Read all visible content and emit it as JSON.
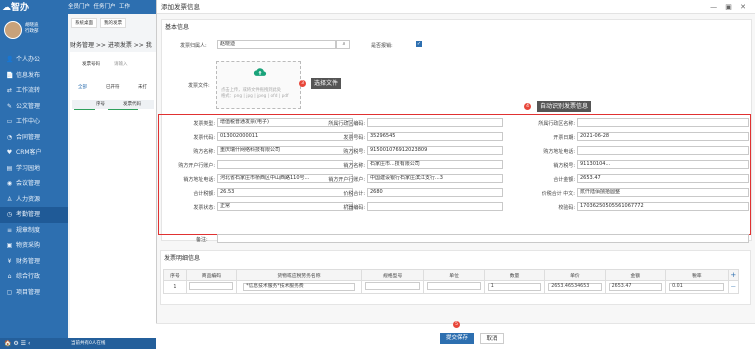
{
  "app": {
    "logo": "智办",
    "user_line1": "胡晓迪",
    "user_line2": "行政部"
  },
  "topbar": {
    "portal1": "全员门户",
    "portal2": "任务门户",
    "portal3": "工作"
  },
  "sidebar": {
    "items": [
      {
        "label": "个人办公",
        "icon": "user-icon"
      },
      {
        "label": "信息发布",
        "icon": "document-icon"
      },
      {
        "label": "工作流转",
        "icon": "flow-icon"
      },
      {
        "label": "公文管理",
        "icon": "file-icon"
      },
      {
        "label": "工作中心",
        "icon": "monitor-icon"
      },
      {
        "label": "合同管理",
        "icon": "contract-icon"
      },
      {
        "label": "CRM客户",
        "icon": "crm-icon"
      },
      {
        "label": "学习园地",
        "icon": "book-icon"
      },
      {
        "label": "会议管理",
        "icon": "meeting-icon"
      },
      {
        "label": "人力资源",
        "icon": "people-icon"
      },
      {
        "label": "考勤管理",
        "icon": "clock-icon"
      },
      {
        "label": "规章制度",
        "icon": "rules-icon"
      },
      {
        "label": "物资采购",
        "icon": "cart-icon"
      },
      {
        "label": "财务管理",
        "icon": "finance-icon"
      },
      {
        "label": "综合行政",
        "icon": "admin-icon"
      },
      {
        "label": "项目管理",
        "icon": "project-icon"
      }
    ],
    "bottom": "首页"
  },
  "background": {
    "tab1": "系统桌面",
    "tab2": "我的发票",
    "breadcrumb": "财务管理 >> 进项发票 >> 我",
    "filter1": "发票号码",
    "filter2": "请输入",
    "subtab1": "全部",
    "subtab2": "已开符",
    "subtab3": "未打",
    "add_button": "添加",
    "batch_button": "批量添加",
    "col_seq": "序号",
    "col_code": "发票代码",
    "footer": "当前共有0人在线"
  },
  "dialog": {
    "title": "添加发票信息",
    "win_controls": "— ▣ ✕",
    "section1_title": "基本信息",
    "applicant_label": "发票归属人:",
    "applicant_value": "赵晓迪",
    "reimbursed_label": "是否报销:",
    "file_label": "发票文件:",
    "upload_hint1": "点击上传，或将文件拖拽到此处",
    "upload_hint2": "格式：png | jpg | jpeg | ofd | pdf",
    "step3": "3",
    "step3_tip": "选择文件",
    "step4": "4",
    "step4_tip": "自动识别发票信息",
    "fields": [
      {
        "label": "发票类型:",
        "value": "增值税普通发票(电子)"
      },
      {
        "label": "所属行政区编码:",
        "value": ""
      },
      {
        "label": "所属行政区名称:",
        "value": ""
      },
      {
        "label": "发票代码:",
        "value": "013002000011"
      },
      {
        "label": "发票号码:",
        "value": "35296545"
      },
      {
        "label": "开票日期:",
        "value": "2021-06-28"
      },
      {
        "label": "购方名称:",
        "value": "重庆瑞什网络科技有限公司"
      },
      {
        "label": "购方税号:",
        "value": "9150010769120238​09"
      },
      {
        "label": "购方地址电话:",
        "value": ""
      },
      {
        "label": "购方开户行账户:",
        "value": ""
      },
      {
        "label": "销方名称:",
        "value": "石家庄市...技有限公司"
      },
      {
        "label": "销方税号:",
        "value": "91130104..."
      },
      {
        "label": "销方地址电话:",
        "value": "河北省石家庄市桥西区中山西路110号..."
      },
      {
        "label": "销方开户行账户:",
        "value": "中国建设银行石家庄滨江支行...3"
      },
      {
        "label": "合计金额:",
        "value": "2653.47"
      },
      {
        "label": "合计税额:",
        "value": "26.53"
      },
      {
        "label": "价税合计:",
        "value": "2680"
      },
      {
        "label": "价税合计 中文:",
        "value": "贰仟陆佰捌拾圆整"
      },
      {
        "label": "发票状态:",
        "value": "正常"
      },
      {
        "label": "机器编码:",
        "value": ""
      },
      {
        "label": "校验码:",
        "value": "17036250505561067772"
      }
    ],
    "remark_label": "备注:",
    "section2_title": "发票明细信息",
    "detail_headers": [
      "序号",
      "商品编码",
      "货物或应税劳务名称",
      "规格型号",
      "单位",
      "数量",
      "单价",
      "金额",
      "税率"
    ],
    "detail_row": [
      "1",
      "",
      "*信息技术服务*技术服务费",
      "",
      "",
      "1",
      "2653.4653465​3",
      "2653.47",
      "0.01"
    ],
    "add_row": "+",
    "remove_row": "—",
    "step5": "5",
    "save_button": "提交保存",
    "cancel_button": "取消"
  }
}
